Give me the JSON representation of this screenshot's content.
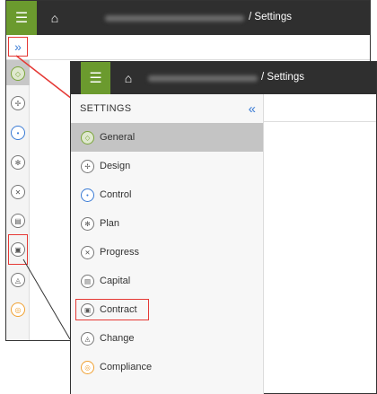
{
  "breadcrumb": {
    "separator": "/",
    "current": "Settings"
  },
  "icons": {
    "menu": "hamburger-icon",
    "home": "home-icon",
    "expand": "double-chevron-right-icon",
    "collapse": "double-chevron-left-icon"
  },
  "colors": {
    "accent_green": "#6b9a2e",
    "topbar": "#2f2f2f",
    "highlight_red": "#e53935",
    "link_blue": "#3a7bd5",
    "selected_bg": "#c4c4c4"
  },
  "rail": {
    "items": [
      {
        "name": "general",
        "glyph": "◇"
      },
      {
        "name": "design",
        "glyph": "✢"
      },
      {
        "name": "control",
        "glyph": "•"
      },
      {
        "name": "plan",
        "glyph": "✻"
      },
      {
        "name": "progress",
        "glyph": "✕"
      },
      {
        "name": "capital",
        "glyph": "▤"
      },
      {
        "name": "contract",
        "glyph": "▣"
      },
      {
        "name": "change",
        "glyph": "◬"
      },
      {
        "name": "compliance",
        "glyph": "◎"
      }
    ]
  },
  "settings_panel": {
    "title": "SETTINGS",
    "collapse_glyph": "«",
    "expand_glyph": "»",
    "items": [
      {
        "label": "General",
        "glyph": "◇",
        "tone": "green",
        "selected": true
      },
      {
        "label": "Design",
        "glyph": "✢",
        "tone": "",
        "selected": false
      },
      {
        "label": "Control",
        "glyph": "•",
        "tone": "blue",
        "selected": false
      },
      {
        "label": "Plan",
        "glyph": "✻",
        "tone": "",
        "selected": false
      },
      {
        "label": "Progress",
        "glyph": "✕",
        "tone": "",
        "selected": false
      },
      {
        "label": "Capital",
        "glyph": "▤",
        "tone": "",
        "selected": false
      },
      {
        "label": "Contract",
        "glyph": "▣",
        "tone": "",
        "selected": false
      },
      {
        "label": "Change",
        "glyph": "◬",
        "tone": "",
        "selected": false
      },
      {
        "label": "Compliance",
        "glyph": "◎",
        "tone": "orange",
        "selected": false
      }
    ]
  },
  "glyphs": {
    "hamburger": "☰",
    "home": "⌂"
  }
}
